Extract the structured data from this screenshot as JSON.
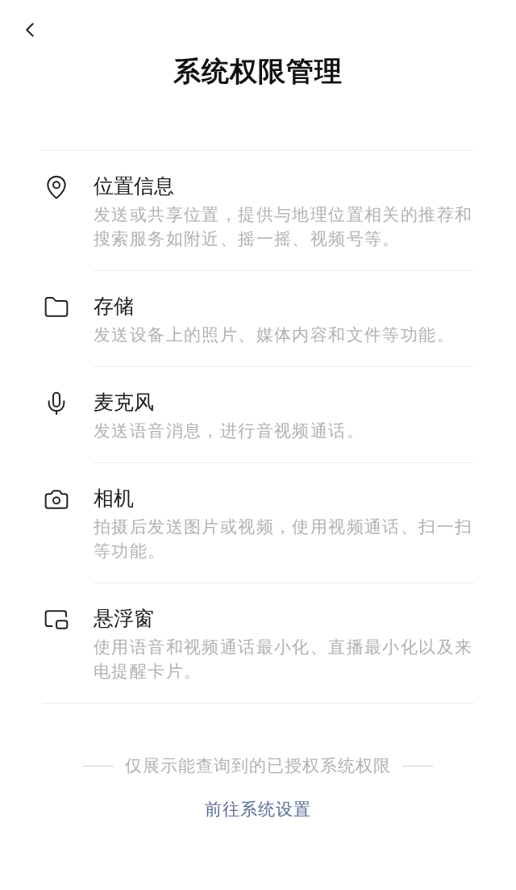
{
  "header": {
    "title": "系统权限管理"
  },
  "permissions": [
    {
      "kind": "location",
      "name": "位置信息",
      "description": "发送或共享位置，提供与地理位置相关的推荐和搜索服务如附近、摇一摇、视频号等。"
    },
    {
      "kind": "storage",
      "name": "存储",
      "description": "发送设备上的照片、媒体内容和文件等功能。"
    },
    {
      "kind": "microphone",
      "name": "麦克风",
      "description": "发送语音消息，进行音视频通话。"
    },
    {
      "kind": "camera",
      "name": "相机",
      "description": "拍摄后发送图片或视频，使用视频通话、扫一扫等功能。"
    },
    {
      "kind": "floating_window",
      "name": "悬浮窗",
      "description": "使用语音和视频通话最小化、直播最小化以及来电提醒卡片。"
    }
  ],
  "footer": {
    "note": "仅展示能查询到的已授权系统权限",
    "link": "前往系统设置"
  }
}
